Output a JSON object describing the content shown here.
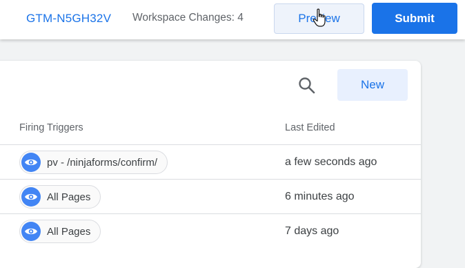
{
  "header": {
    "container_id": "GTM-N5GH32V",
    "workspace_changes": "Workspace Changes: 4",
    "preview_label": "Preview",
    "submit_label": "Submit"
  },
  "toolbar": {
    "search_icon": "search-icon",
    "new_label": "New"
  },
  "table": {
    "columns": [
      "Firing Triggers",
      "Last Edited"
    ],
    "rows": [
      {
        "trigger": "pv - /ninjaforms/confirm/",
        "trigger_icon": "eye-icon",
        "last_edited": "a few seconds ago"
      },
      {
        "trigger": "All Pages",
        "trigger_icon": "eye-icon",
        "last_edited": "6 minutes ago"
      },
      {
        "trigger": "All Pages",
        "trigger_icon": "eye-icon",
        "last_edited": "7 days ago"
      }
    ]
  },
  "colors": {
    "accent": "#1a73e8",
    "trigger_icon_bg": "#4285f4"
  }
}
